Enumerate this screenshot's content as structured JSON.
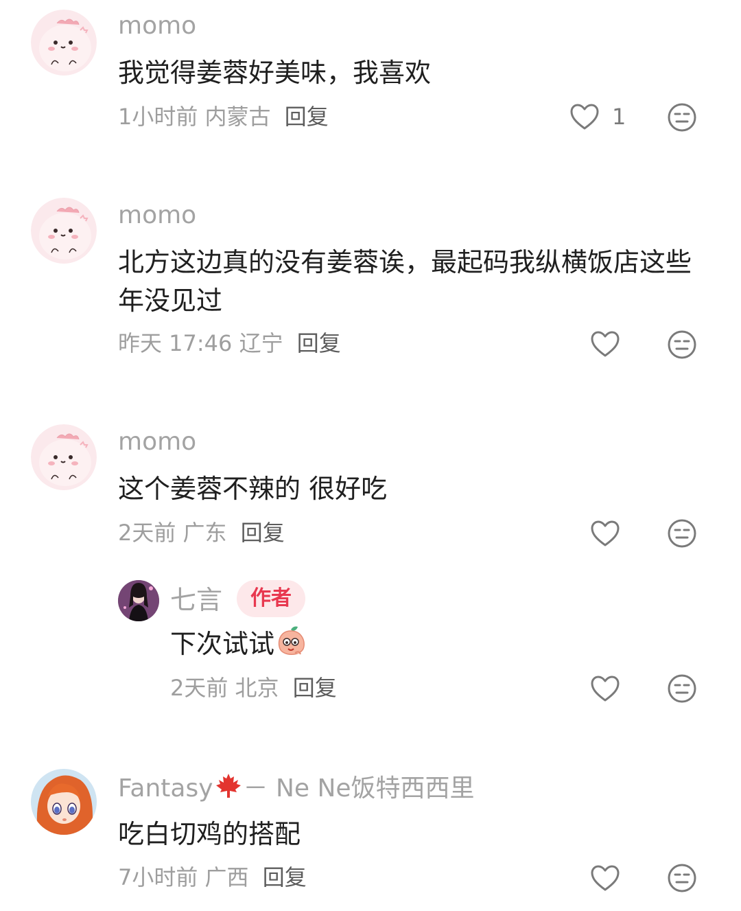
{
  "comments": [
    {
      "name": "momo",
      "text": "我觉得姜蓉好美味，我喜欢",
      "time": "1小时前",
      "location": "内蒙古",
      "reply": "回复",
      "likes": "1"
    },
    {
      "name": "momo",
      "text": "北方这边真的没有姜蓉诶，最起码我纵横饭店这些年没见过",
      "time": "昨天 17:46",
      "location": "辽宁",
      "reply": "回复",
      "likes": ""
    },
    {
      "name": "momo",
      "text": "这个姜蓉不辣的 很好吃",
      "time": "2天前",
      "location": "广东",
      "reply": "回复",
      "likes": ""
    },
    {
      "name": "七言",
      "badge": "作者",
      "text": "下次试试",
      "emoji": "peach-face-emoji",
      "time": "2天前",
      "location": "北京",
      "reply": "回复",
      "likes": ""
    },
    {
      "name_prefix": "Fantasy",
      "name_icon": "maple-leaf-icon",
      "name_suffix": "－ Ne Ne饭特西西里",
      "text": "吃白切鸡的搭配",
      "time": "7小时前",
      "location": "广西",
      "reply": "回复",
      "likes": ""
    }
  ],
  "colors": {
    "name": "#a3a3a3",
    "text": "#1f1f1f",
    "meta": "#9e9e9e",
    "badge_bg": "#fde8ea",
    "badge_text": "#e8384f"
  },
  "icons": {
    "like": "heart-outline-icon",
    "dislike": "neutral-face-icon"
  }
}
